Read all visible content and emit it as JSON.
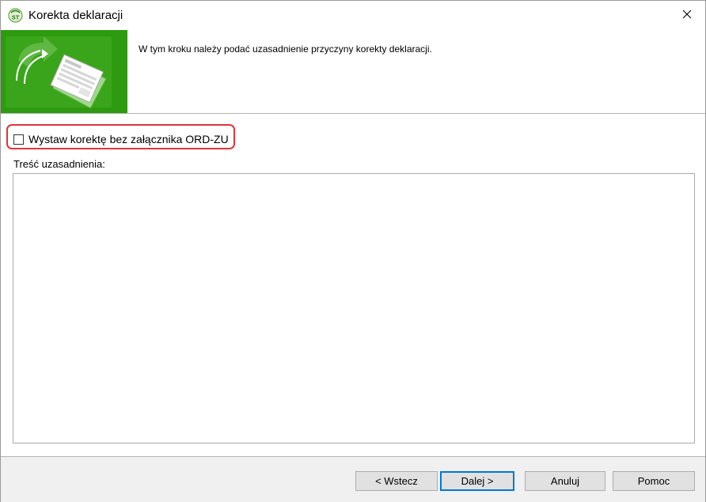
{
  "window": {
    "title": "Korekta deklaracji",
    "close_glyph": "✕"
  },
  "icons": {
    "app": "st-app-icon",
    "close": "close-icon",
    "banner": "document-correction-illustration"
  },
  "colors": {
    "banner_green": "#2e9a10",
    "highlight_red": "#e0343c",
    "default_button_border": "#0078d7"
  },
  "header": {
    "step_description": "W tym kroku należy podać uzasadnienie przyczyny korekty deklaracji."
  },
  "form": {
    "checkbox_label": "Wystaw korektę bez załącznika ORD-ZU",
    "checkbox_checked": false,
    "reason_label": "Treść uzasadnienia:",
    "reason_value": ""
  },
  "footer": {
    "back_label": "< Wstecz",
    "next_label": "Dalej >",
    "cancel_label": "Anuluj",
    "help_label": "Pomoc"
  }
}
